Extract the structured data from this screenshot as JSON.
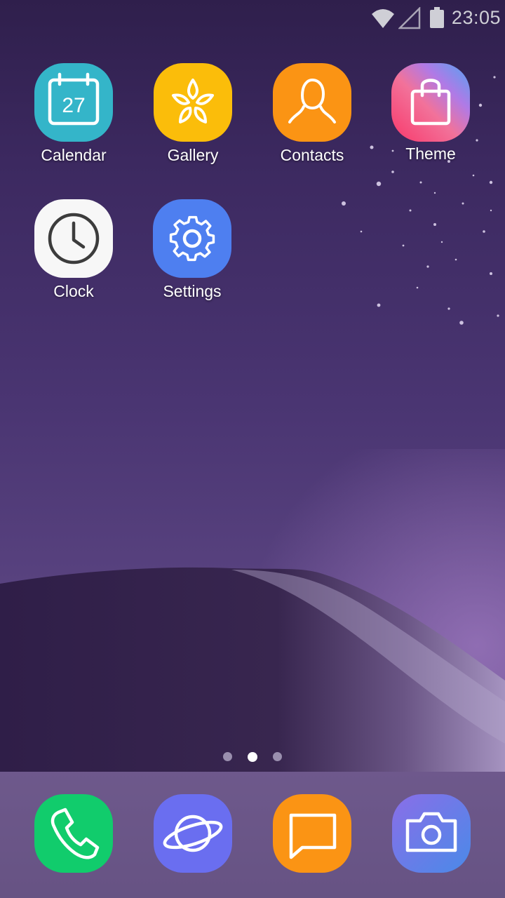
{
  "status_bar": {
    "time": "23:05",
    "icons": [
      "wifi-icon",
      "cell-signal-icon",
      "battery-icon"
    ]
  },
  "apps": [
    {
      "label": "Calendar",
      "icon": "calendar-icon",
      "date": "27",
      "color": "#34b5c9"
    },
    {
      "label": "Gallery",
      "icon": "flower-icon",
      "color": "#fbbd0a"
    },
    {
      "label": "Contacts",
      "icon": "person-icon",
      "color": "#fb9414"
    },
    {
      "label": "Theme",
      "icon": "shopping-bag-icon",
      "color": "#e85a8c"
    },
    {
      "label": "Clock",
      "icon": "clock-icon",
      "color": "#f7f7f7"
    },
    {
      "label": "Settings",
      "icon": "gear-icon",
      "color": "#4e7ff0"
    }
  ],
  "page_indicator": {
    "pages": 3,
    "active_page": 2
  },
  "dock": [
    {
      "name": "Phone",
      "icon": "phone-icon",
      "color": "#11cc6c"
    },
    {
      "name": "Internet",
      "icon": "planet-icon",
      "color": "#6a6ef0"
    },
    {
      "name": "Messages",
      "icon": "chat-icon",
      "color": "#fb9414"
    },
    {
      "name": "Camera",
      "icon": "camera-icon",
      "color": "#6a78e8"
    }
  ],
  "colors": {
    "wallpaper_sky": "#3c2960",
    "wallpaper_hill": "#34224e",
    "dock_background": "#8a7899"
  }
}
